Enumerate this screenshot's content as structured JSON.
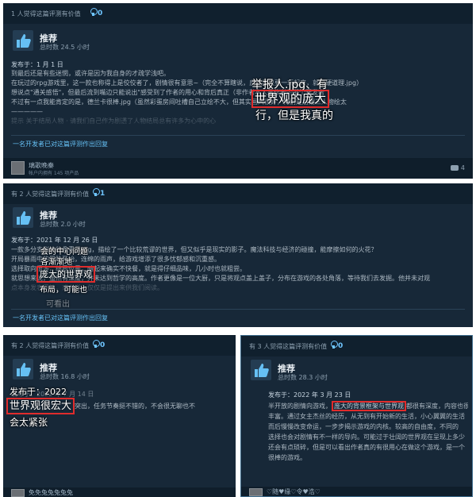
{
  "review1": {
    "helpful": "1 人觉得这篇评测有价值",
    "award_count": "0",
    "recommendation": "推荐",
    "hours": "总时数 24.5 小时",
    "posted": "发布于：1 月 1 日",
    "lines": [
      "到最后还是有些迷惘，或许是因为我自身的才疏学浅吧。",
      "在玩过的rpg游戏里，这一款也称得上是佼佼者了，剧情很有意思~（完全不算瞎说，反正我只要一玩起来，就是硬道理.jpg）",
      "想说点\"通关感悟\"，但最后流到嘴边只能说出\"感受到了作者的用心和背后真正（非作者本人是作者的那个开发者",
      "不过有一点我能肯定的是，德兰卡很棒.jpg（虽然彩蛋房间吐槽自己立绘不大，但其实画风很好，特别是后期三人物绘太",
      "—————",
      "提示 关于结局人物 · 请我们自己作为剧透了人物结局总有许多为心中的心"
    ],
    "overlay_lines": [
      "举报人.jpg、有",
      "行，但是我真的"
    ],
    "highlight": "世界观的庞大",
    "dev_response": "一名开发者已对这篇评测作出回复",
    "user": "璃歌晚秦",
    "user_sub": "帐户内拥有 145 项产品",
    "comments": "4"
  },
  "review2": {
    "helpful": "有 2 人觉得这篇评测有价值",
    "award_count": "1",
    "recommendation": "推荐",
    "hours": "总时数 2.0 小时",
    "posted": "发布于：2021 年 12 月 26 日",
    "lines": [
      "一款多分支剧情的像素风rpg，描绘了一个比较荒谬的世界，但又似乎是现实的影子。魔法科技与经济的碰撞，能摩擦如何的火花？",
      "开局暴雨中的冒险开始，连绵的雨声，给游戏增添了很多忧郁感和沉重感。",
      "选择取向很多，结局也是，暗起来确实不快餐，就是得仔细品味，几小时也就粗尝。",
      "就思想来说，虽然有深度，并未达到哲学的高度。作者更像是一位大厨，只是将观点盖上盖子，分布在游戏的各处角落，等待我们去发掘。他并未对观",
      "点本身发表看法，或者说，仅仅是提出来供我们阅读。"
    ],
    "overlay_lines": [
      "会的中心问题",
      "各渐渐地",
      "布局，可能也",
      "可看出"
    ],
    "highlight": "庞大的世界观",
    "dev_response": "一名开发者已对这篇评测作出回复"
  },
  "review3": {
    "helpful": "有 2 人觉得这篇评测有价值",
    "award_count": "0",
    "recommendation": "推荐",
    "hours": "总时数 16.8 小时",
    "posted": "发布于：2022 年 7 月 14 日",
    "line_tail": "画风不错，人物形象很突出，任务节奏挺不错的，不会很无聊也不",
    "overlay_posted": "发布于：2022",
    "highlight": "世界观很宏大",
    "overlay_text": "会太紧张",
    "user": "免免兔兔兔兔兔"
  },
  "review4": {
    "helpful": "有 3 人觉得这篇评测有价值",
    "award_count": "0",
    "recommendation": "推荐",
    "hours": "总时数 28.3 小时",
    "posted": "发布于：2022 年 3 月 23 日",
    "line1_pre": "半开放的剧情向游戏，",
    "highlight": "庞大的背景框架与世界观",
    "line1_post": "都很有深度，内容也很",
    "lines": [
      "丰富。通过女主杰丝的经历，从无到有开始新的生活，小心翼翼的生活",
      "而后慢慢改变命运，一步步揭示游戏的内核。较高的自由度，不同的",
      "选择也会对剧情有不一样的导向。可能过于壮阔的世界观在呈现上多少",
      "还会有点琐碎，但是可以看出作者真的有很用心在做这个游戏，是一个",
      "很棒的游戏。"
    ],
    "user": "♡随♥缘♡令♥浩♡"
  }
}
